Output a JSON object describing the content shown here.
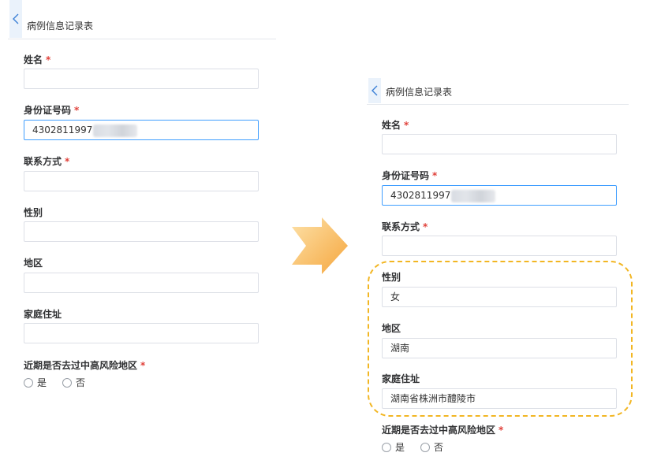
{
  "left": {
    "title": "病例信息记录表",
    "fields": {
      "name": {
        "label": "姓名",
        "required": "*",
        "value": ""
      },
      "id_card": {
        "label": "身份证号码",
        "required": "*",
        "value": "4302811997"
      },
      "contact": {
        "label": "联系方式",
        "required": "*",
        "value": ""
      },
      "gender": {
        "label": "性别",
        "value": ""
      },
      "region": {
        "label": "地区",
        "value": ""
      },
      "address": {
        "label": "家庭住址",
        "value": ""
      }
    },
    "risk": {
      "label": "近期是否去过中高风险地区",
      "required": "*",
      "yes": "是",
      "no": "否"
    }
  },
  "right": {
    "title": "病例信息记录表",
    "fields": {
      "name": {
        "label": "姓名",
        "required": "*",
        "value": ""
      },
      "id_card": {
        "label": "身份证号码",
        "required": "*",
        "value": "4302811997"
      },
      "contact": {
        "label": "联系方式",
        "required": "*",
        "value": ""
      },
      "gender": {
        "label": "性别",
        "value": "女"
      },
      "region": {
        "label": "地区",
        "value": "湖南"
      },
      "address": {
        "label": "家庭住址",
        "value": "湖南省株洲市醴陵市"
      }
    },
    "risk": {
      "label": "近期是否去过中高风险地区",
      "required": "*",
      "yes": "是",
      "no": "否"
    }
  },
  "colors": {
    "accent": "#409eff",
    "required": "#e0413a",
    "highlight": "#f2b623",
    "arrow": "#f7b24a"
  },
  "icons": {
    "back": "chevron-left-icon",
    "transition": "arrow-right-icon"
  }
}
